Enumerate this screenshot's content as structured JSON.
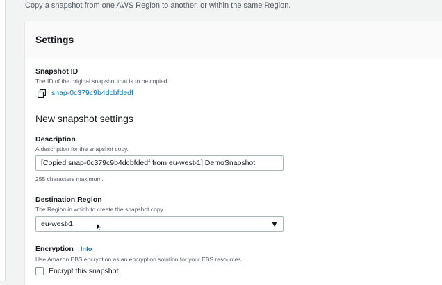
{
  "intro_text": "Copy a snapshot from one AWS Region to another, or within the same Region.",
  "settings": {
    "title": "Settings",
    "snapshot_id": {
      "label": "Snapshot ID",
      "hint": "The ID of the original snapshot that is to be copied.",
      "value": "snap-0c379c9b4dcbfdedf",
      "icon": "copy-icon"
    },
    "new_section_title": "New snapshot settings",
    "description": {
      "label": "Description",
      "hint": "A description for the snapshot copy.",
      "value": "[Copied snap-0c379c9b4dcbfdedf from eu-west-1] DemoSnapshot",
      "constraint": "255 characters maximum."
    },
    "destination_region": {
      "label": "Destination Region",
      "hint": "The Region in which to create the snapshot copy.",
      "selected": "eu-west-1"
    },
    "encryption": {
      "label": "Encryption",
      "info": "Info",
      "hint": "Use Amazon EBS encryption as an encryption solution for your EBS resources.",
      "checkbox_label": "Encrypt this snapshot",
      "checked": false
    }
  },
  "colors": {
    "link": "#0073bb",
    "background": "#f2f3f3",
    "border": "#aab7b8"
  }
}
